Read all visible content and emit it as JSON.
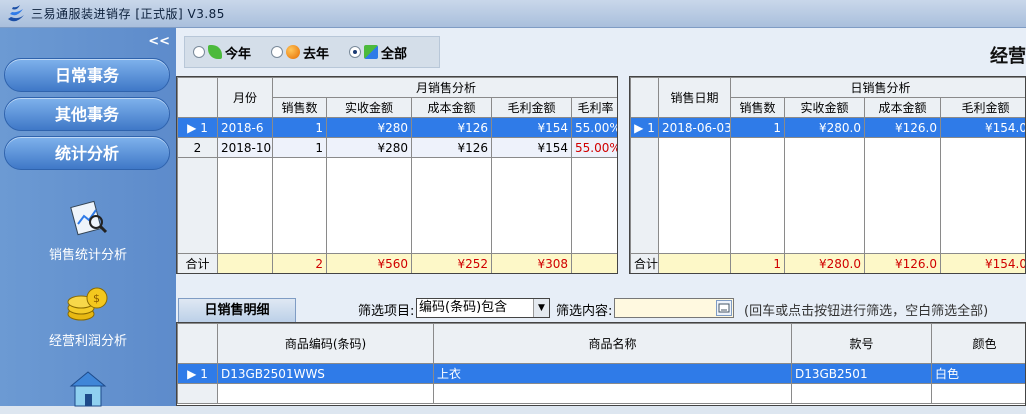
{
  "app": {
    "title": "三易通服装进销存 [正式版] V3.85"
  },
  "sidebar": {
    "collapse_label": "<<",
    "nav_buttons": [
      "日常事务",
      "其他事务",
      "统计分析"
    ],
    "items": [
      {
        "label": "销售统计分析",
        "icon": "chart-magnifier-icon"
      },
      {
        "label": "经营利润分析",
        "icon": "gold-coins-icon"
      },
      {
        "label": "",
        "icon": "house-icon"
      }
    ]
  },
  "toolbar": {
    "radios": [
      {
        "label": "今年",
        "selected": false
      },
      {
        "label": "去年",
        "selected": false
      },
      {
        "label": "全部",
        "selected": true
      }
    ],
    "page_title": "经营"
  },
  "monthly": {
    "group_title": "月销售分析",
    "month_header": "月份",
    "columns": [
      "销售数",
      "实收金额",
      "成本金额",
      "毛利金额",
      "毛利率"
    ],
    "rows": [
      {
        "index": "1",
        "month": "2018-6",
        "qty": "1",
        "received": "¥280",
        "cost": "¥126",
        "profit": "¥154",
        "rate": "55.00%"
      },
      {
        "index": "2",
        "month": "2018-10",
        "qty": "1",
        "received": "¥280",
        "cost": "¥126",
        "profit": "¥154",
        "rate": "55.00%"
      }
    ],
    "total": {
      "label": "合计",
      "qty": "2",
      "received": "¥560",
      "cost": "¥252",
      "profit": "¥308",
      "rate": ""
    }
  },
  "daily": {
    "group_title": "日销售分析",
    "date_header": "销售日期",
    "columns": [
      "销售数",
      "实收金额",
      "成本金额",
      "毛利金额"
    ],
    "rows": [
      {
        "index": "1",
        "date": "2018-06-03",
        "qty": "1",
        "received": "¥280.0",
        "cost": "¥126.0",
        "profit": "¥154.0"
      }
    ],
    "total": {
      "label": "合计",
      "qty": "1",
      "received": "¥280.0",
      "cost": "¥126.0",
      "profit": "¥154.0"
    }
  },
  "detail": {
    "tab_label": "日销售明细",
    "filter_item_label": "筛选项目:",
    "filter_item_value": "编码(条码)包含",
    "filter_content_label": "筛选内容:",
    "hint": "(回车或点击按钮进行筛选，空白筛选全部)",
    "columns": [
      "商品编码(条码)",
      "商品名称",
      "款号",
      "颜色"
    ],
    "rows": [
      {
        "index": "1",
        "code": "D13GB2501WWS",
        "name": "上衣",
        "style": "D13GB2501",
        "color": "白色"
      }
    ]
  },
  "colors": {
    "selected_row": "#2f7be8",
    "total_row": "#fdf8c8",
    "negative_text": "#d00000"
  }
}
